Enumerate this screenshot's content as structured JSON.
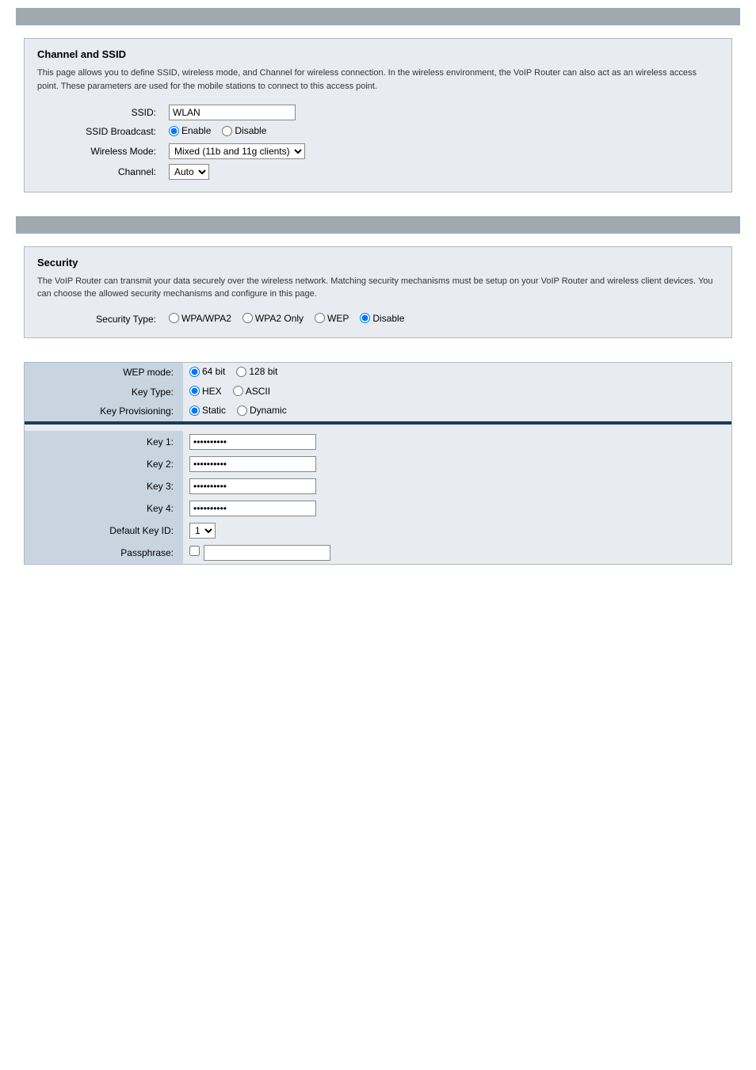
{
  "section1": {
    "header": "",
    "card_title": "Channel and SSID",
    "card_desc": "This page allows you to define SSID, wireless mode, and Channel for wireless connection.  In the wireless environment, the VoIP Router can also act as an wireless access point.  These parameters are used for the mobile stations to connect to this access point.",
    "ssid_label": "SSID:",
    "ssid_value": "WLAN",
    "ssid_broadcast_label": "SSID Broadcast:",
    "ssid_broadcast_enable": "Enable",
    "ssid_broadcast_disable": "Disable",
    "wireless_mode_label": "Wireless Mode:",
    "wireless_mode_value": "Mixed (11b and 11g clients)",
    "channel_label": "Channel:",
    "channel_value": "Auto"
  },
  "section2": {
    "header": "",
    "card_title": "Security",
    "card_desc": "The VoIP Router can transmit your data securely over the wireless network. Matching security mechanisms must be setup on your VoIP Router and wireless client devices. You can choose the allowed security mechanisms and configure in this page.",
    "security_type_label": "Security Type:",
    "security_wpa_wpa2": "WPA/WPA2",
    "security_wpa2_only": "WPA2 Only",
    "security_wep": "WEP",
    "security_disable": "Disable"
  },
  "wep": {
    "wep_mode_label": "WEP mode:",
    "wep_64bit": "64 bit",
    "wep_128bit": "128 bit",
    "key_type_label": "Key Type:",
    "key_type_hex": "HEX",
    "key_type_ascii": "ASCII",
    "key_provisioning_label": "Key Provisioning:",
    "key_provisioning_static": "Static",
    "key_provisioning_dynamic": "Dynamic",
    "key1_label": "Key 1:",
    "key2_label": "Key 2:",
    "key3_label": "Key 3:",
    "key4_label": "Key 4:",
    "default_key_id_label": "Default Key ID:",
    "default_key_id_value": "1",
    "passphrase_label": "Passphrase:",
    "passphrase_value": ""
  }
}
